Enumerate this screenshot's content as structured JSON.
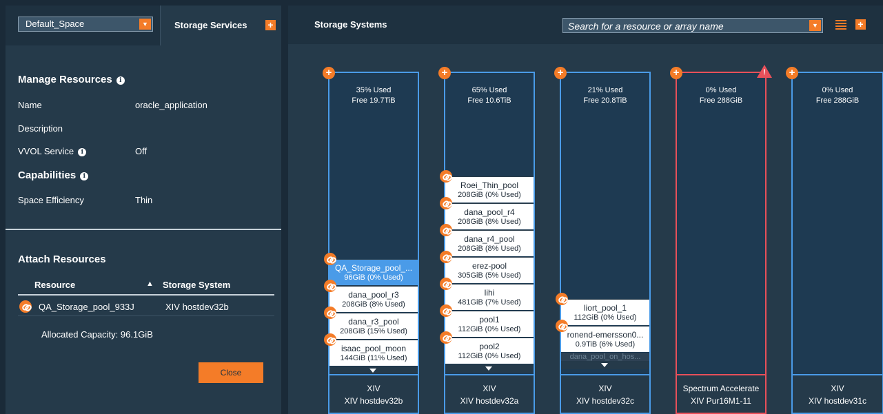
{
  "left": {
    "space_select": "Default_Space",
    "tab_storage_services": "Storage Services",
    "manage_resources_title": "Manage Resources",
    "props": [
      {
        "key": "Name",
        "value": "oracle_application"
      },
      {
        "key": "Description",
        "value": ""
      },
      {
        "key": "VVOL Service",
        "value": "Off"
      }
    ],
    "capabilities_title": "Capabilities",
    "capabilities": [
      {
        "key": "Space Efficiency",
        "value": "Thin"
      }
    ],
    "attach_title": "Attach Resources",
    "table": {
      "col_resource": "Resource",
      "sort_arrow": "▲",
      "col_system": "Storage System",
      "rows": [
        {
          "resource": "QA_Storage_pool_933J",
          "system": "XIV hostdev32b"
        }
      ]
    },
    "allocated": "Allocated Capacity: 96.1GiB",
    "close_label": "Close"
  },
  "right": {
    "title": "Storage Systems",
    "search_placeholder": "Search for a resource or array name",
    "systems": [
      {
        "used": "35% Used",
        "free": "Free 19.7TiB",
        "type": "XIV",
        "name": "XIV hostdev32b",
        "warning": false,
        "pools": [
          {
            "name": "QA_Storage_pool_...",
            "usage": "96GiB (0% Used)",
            "selected": true
          },
          {
            "name": "dana_pool_r3",
            "usage": "208GiB (8% Used)"
          },
          {
            "name": "dana_r3_pool",
            "usage": "208GiB (15% Used)"
          },
          {
            "name": "isaac_pool_moon",
            "usage": "144GiB (11% Used)"
          }
        ]
      },
      {
        "used": "65% Used",
        "free": "Free 10.6TiB",
        "type": "XIV",
        "name": "XIV hostdev32a",
        "warning": false,
        "pools": [
          {
            "name": "Roei_Thin_pool",
            "usage": "208GiB (0% Used)"
          },
          {
            "name": "dana_pool_r4",
            "usage": "208GiB (8% Used)"
          },
          {
            "name": "dana_r4_pool",
            "usage": "208GiB (8% Used)"
          },
          {
            "name": "erez-pool",
            "usage": "305GiB (5% Used)"
          },
          {
            "name": "lihi",
            "usage": "481GiB (7% Used)"
          },
          {
            "name": "pool1",
            "usage": "112GiB (0% Used)"
          },
          {
            "name": "pool2",
            "usage": "112GiB (0% Used)"
          }
        ]
      },
      {
        "used": "21% Used",
        "free": "Free 20.8TiB",
        "type": "XIV",
        "name": "XIV hostdev32c",
        "warning": false,
        "pools": [
          {
            "name": "liort_pool_1",
            "usage": "112GiB (0% Used)"
          },
          {
            "name": "ronend-emersson0...",
            "usage": "0.9TiB (6% Used)"
          }
        ],
        "dim_pool": "dana_pool_on_hos..."
      },
      {
        "used": "0% Used",
        "free": "Free 288GiB",
        "type": "Spectrum Accelerate",
        "name": "XIV Pur16M1-11",
        "warning": true,
        "pools": []
      },
      {
        "used": "0% Used",
        "free": "Free 288GiB",
        "type": "XIV",
        "name": "XIV hostdev31c",
        "warning": false,
        "pools": []
      }
    ]
  },
  "colors": {
    "accent": "#f47c28",
    "system_border": "#4a9be8",
    "warning": "#e8505a",
    "panel": "#253a4a"
  }
}
